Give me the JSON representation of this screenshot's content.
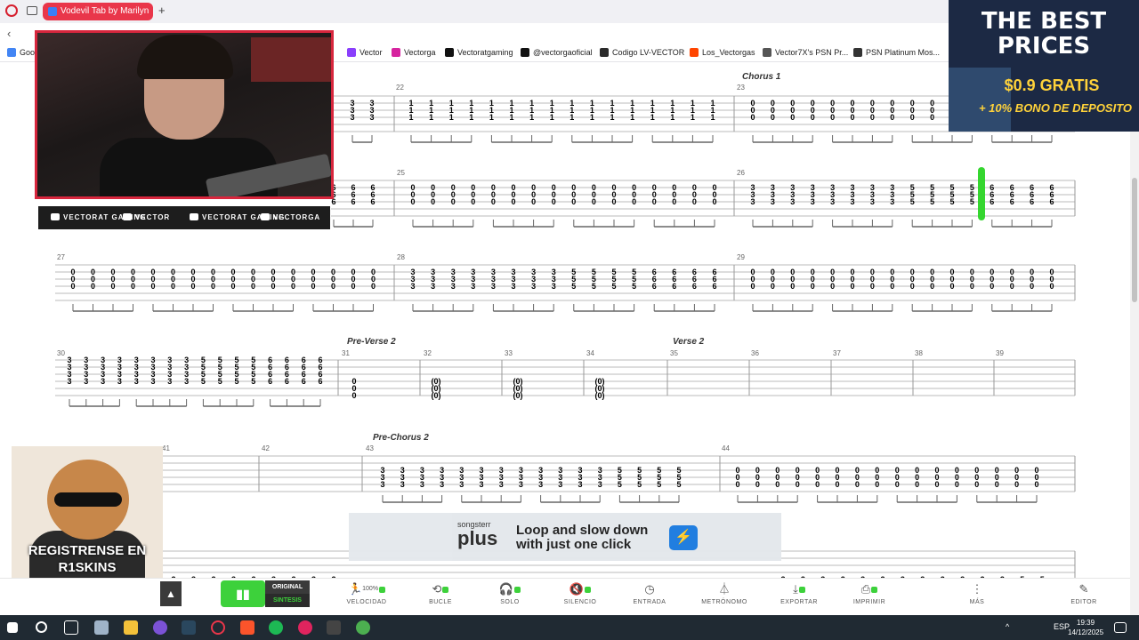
{
  "browser": {
    "tab_title": "Vodevil Tab by Marilyn",
    "new_tab": "+",
    "bookmarks": [
      {
        "label": "Goog",
        "color": "#4285f4"
      },
      {
        "label": "Vector",
        "color": "#8a3ffc"
      },
      {
        "label": "Vectorga",
        "color": "#d6249f"
      },
      {
        "label": "Vectoratgaming",
        "color": "#111111"
      },
      {
        "label": "@vectorgaoficial",
        "color": "#111111"
      },
      {
        "label": "Codigo LV-VECTOR",
        "color": "#2b2b2b"
      },
      {
        "label": "Los_Vectorgas",
        "color": "#ff4500"
      },
      {
        "label": "Vector7X's PSN Pr...",
        "color": "#555555"
      },
      {
        "label": "PSN Platinum Mos...",
        "color": "#333333"
      }
    ]
  },
  "score": {
    "section_labels": {
      "chorus1": "Chorus 1",
      "preverse2": "Pre-Verse 2",
      "verse2": "Verse 2",
      "prechorus2": "Pre-Chorus 2"
    },
    "bar_numbers": {
      "b22": "22",
      "b23": "23",
      "b25": "25",
      "b26": "26",
      "b27": "27",
      "b28": "28",
      "b29": "29",
      "b30": "30",
      "b31": "31",
      "b32": "32",
      "b33": "33",
      "b34": "34",
      "b35": "35",
      "b36": "36",
      "b37": "37",
      "b38": "38",
      "b39": "39",
      "b41": "41",
      "b42": "42",
      "b43": "43",
      "b44": "44"
    }
  },
  "overlay": {
    "socials": [
      {
        "label": "VECTORAT GAMING"
      },
      {
        "label": "VECTOR"
      },
      {
        "label": "VECTORAT GAMING"
      },
      {
        "label": "VECTORGA"
      }
    ],
    "ad": {
      "headline": "THE BEST PRICES",
      "price": "$0.9 GRATIS",
      "bonus": "+ 10% BONO DE DEPOSITO"
    },
    "cat_text": "REGISTRENSE EN R1SKINS"
  },
  "banner": {
    "brand": "songsterr",
    "plus": "plus",
    "message": "Loop and slow down with just one click"
  },
  "toolbar": {
    "mode_original": "ORIGINAL",
    "mode_sintesis": "SINTESIS",
    "speed_value": "100%",
    "tools": [
      {
        "label": "VELOCIDAD",
        "icon": "speed-icon"
      },
      {
        "label": "BUCLE",
        "icon": "loop-icon"
      },
      {
        "label": "SOLO",
        "icon": "headphones-icon"
      },
      {
        "label": "SILENCIO",
        "icon": "mute-icon"
      },
      {
        "label": "ENTRADA",
        "icon": "count-in-icon"
      },
      {
        "label": "METRÓNOMO",
        "icon": "metronome-icon"
      },
      {
        "label": "EXPORTAR",
        "icon": "export-icon"
      },
      {
        "label": "IMPRIMIR",
        "icon": "print-icon"
      },
      {
        "label": "MÁS",
        "icon": "more-icon"
      },
      {
        "label": "EDITOR",
        "icon": "editor-icon"
      }
    ]
  },
  "taskbar": {
    "language": "ESP",
    "time": "19:39",
    "date": "14/12/2025"
  },
  "colors": {
    "accent": "#3dd13b",
    "tab": "#e9364a",
    "cam_border": "#d7263d"
  }
}
